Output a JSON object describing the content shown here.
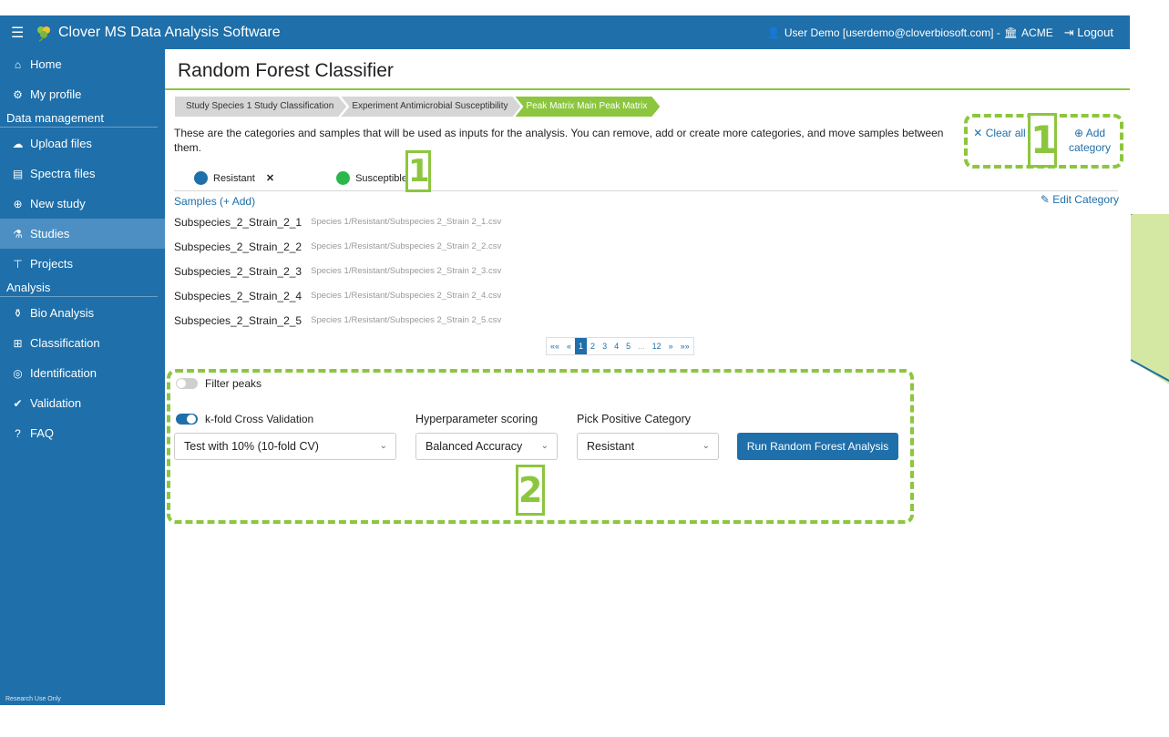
{
  "app": {
    "title": "Clover MS Data Analysis Software",
    "user": "User Demo [userdemo@cloverbiosoft.com] -",
    "org": "ACME",
    "logout": "Logout"
  },
  "sidebar": {
    "items": [
      {
        "label": "Home",
        "icon": "home-icon"
      },
      {
        "label": "My profile",
        "icon": "user-gear-icon"
      }
    ],
    "sections": [
      {
        "title": "Data management",
        "items": [
          {
            "label": "Upload files",
            "icon": "cloud-upload-icon"
          },
          {
            "label": "Spectra files",
            "icon": "file-icon"
          },
          {
            "label": "New study",
            "icon": "plus-circle-icon"
          },
          {
            "label": "Studies",
            "icon": "microscope-icon",
            "active": true
          },
          {
            "label": "Projects",
            "icon": "project-diagram-icon"
          }
        ]
      },
      {
        "title": "Analysis",
        "items": [
          {
            "label": "Bio Analysis",
            "icon": "flask-icon"
          },
          {
            "label": "Classification",
            "icon": "sitemap-icon"
          },
          {
            "label": "Identification",
            "icon": "fingerprint-icon"
          },
          {
            "label": "Validation",
            "icon": "check-double-icon"
          },
          {
            "label": "FAQ",
            "icon": "question-circle-icon"
          }
        ]
      }
    ],
    "footer": "Research Use Only"
  },
  "page": {
    "title": "Random Forest Classifier",
    "breadcrumbs": [
      "Study Species 1 Study Classification",
      "Experiment Antimicrobial Susceptibility",
      "Peak Matrix Main Peak Matrix"
    ],
    "intro": "These are the categories and samples that will be used as inputs for the analysis. You can remove, add or create more categories, and move samples between them.",
    "clear_all": "Clear all",
    "add_category": "Add category",
    "categories": [
      {
        "label": "Resistant",
        "color": "#1e6faa"
      },
      {
        "label": "Susceptible",
        "color": "#2bb84a"
      }
    ],
    "samples_label": "Samples (",
    "samples_add": "+ Add",
    "samples_close": ")",
    "edit_category": "Edit Category",
    "samples": [
      {
        "name": "Subspecies_2_Strain_2_1",
        "path": "Species 1/Resistant/Subspecies 2_Strain 2_1.csv"
      },
      {
        "name": "Subspecies_2_Strain_2_2",
        "path": "Species 1/Resistant/Subspecies 2_Strain 2_2.csv"
      },
      {
        "name": "Subspecies_2_Strain_2_3",
        "path": "Species 1/Resistant/Subspecies 2_Strain 2_3.csv"
      },
      {
        "name": "Subspecies_2_Strain_2_4",
        "path": "Species 1/Resistant/Subspecies 2_Strain 2_4.csv"
      },
      {
        "name": "Subspecies_2_Strain_2_5",
        "path": "Species 1/Resistant/Subspecies 2_Strain 2_5.csv"
      }
    ],
    "pagination": [
      "««",
      "«",
      "1",
      "2",
      "3",
      "4",
      "5",
      "...",
      "12",
      "»",
      "»»"
    ],
    "current_page": "1",
    "filter_peaks": {
      "label": "Filter peaks",
      "on": false
    },
    "kfold": {
      "label": "k-fold Cross Validation",
      "on": true,
      "value": "Test with 10% (10-fold CV)"
    },
    "hyper": {
      "label": "Hyperparameter scoring",
      "value": "Balanced Accuracy"
    },
    "positive": {
      "label": "Pick Positive Category",
      "value": "Resistant"
    },
    "run_button": "Run Random Forest Analysis"
  },
  "annotations": [
    "1",
    "1",
    "2"
  ],
  "colors": {
    "brand_blue": "#1e6faa",
    "accent_green": "#8cc63f"
  }
}
